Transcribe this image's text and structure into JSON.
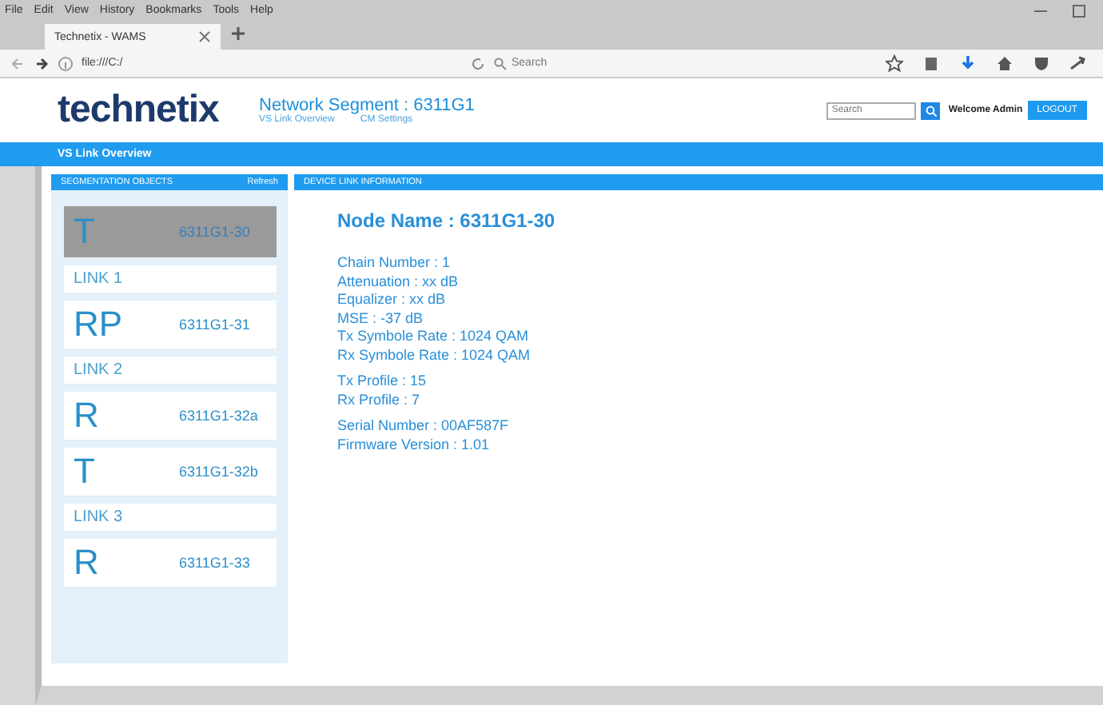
{
  "browser": {
    "menu": [
      "File",
      "Edit",
      "View",
      "History",
      "Bookmarks",
      "Tools",
      "Help"
    ],
    "tab": {
      "title": "Technetix - WAMS"
    },
    "address": "file:///C:/",
    "search": {
      "placeholder": "Search"
    }
  },
  "header": {
    "logo": "technetix",
    "title": "Network Segment : 6311G1",
    "nav": [
      "VS Link Overview",
      "CM Settings"
    ],
    "search": {
      "placeholder": "Search"
    },
    "welcome": "Welcome Admin",
    "logout": "LOGOUT"
  },
  "breadcrumb": "VS Link Overview",
  "left_panel": {
    "title": "SEGMENTATION OBJECTS",
    "refresh": "Refresh",
    "items": [
      {
        "kind": "device",
        "letter": "T",
        "code": "6311G1-30",
        "selected": true
      },
      {
        "kind": "link",
        "label": "LINK 1"
      },
      {
        "kind": "device",
        "letter": "RP",
        "code": "6311G1-31",
        "selected": false
      },
      {
        "kind": "link",
        "label": "LINK 2"
      },
      {
        "kind": "device",
        "letter": "R",
        "code": "6311G1-32a",
        "selected": false
      },
      {
        "kind": "device",
        "letter": "T",
        "code": "6311G1-32b",
        "selected": false
      },
      {
        "kind": "link",
        "label": "LINK 3"
      },
      {
        "kind": "device",
        "letter": "R",
        "code": "6311G1-33",
        "selected": false
      }
    ]
  },
  "right_panel": {
    "title": "DEVICE LINK INFORMATION",
    "node_name": "Node Name : 6311G1-30",
    "groups": [
      [
        "Chain Number : 1",
        "Attenuation :  xx dB",
        "Equalizer :  xx dB",
        "MSE : -37 dB",
        "Tx Symbole Rate : 1024 QAM",
        "Rx Symbole Rate : 1024 QAM"
      ],
      [
        "Tx Profile : 15",
        "Rx Profile : 7"
      ],
      [
        "Serial Number : 00AF587F",
        "Firmware Version : 1.01"
      ]
    ]
  }
}
